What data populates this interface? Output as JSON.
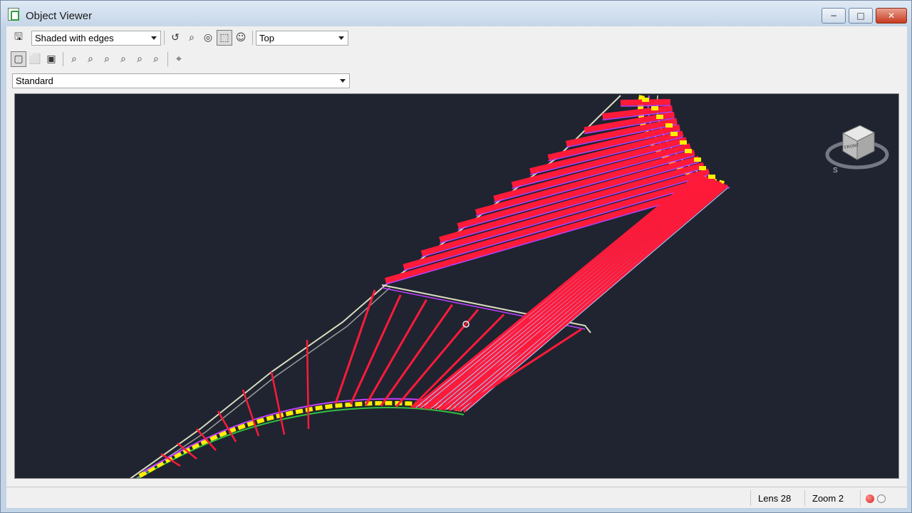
{
  "window": {
    "title": "Object Viewer"
  },
  "toolbar": {
    "visual_style": {
      "value": "Shaded with edges"
    },
    "view": {
      "value": "Top"
    },
    "icons_row1": [
      "save-icon",
      "orbit-icon",
      "zoom-icon",
      "pan-icon",
      "zoom-window-icon",
      "camera-icon"
    ],
    "icons_row2": [
      "view-front-icon",
      "view-iso-icon",
      "view-3d-icon",
      "zoom-in-icon",
      "zoom-out-icon",
      "zoom-extents-icon",
      "zoom-all-icon",
      "zoom-previous-icon",
      "zoom-realtime-icon",
      "crosshair-icon"
    ],
    "style_select": {
      "value": "Standard"
    }
  },
  "viewport": {
    "viewcube_face": "FRONT",
    "compass_letter": "S",
    "background": "#1f2430",
    "colors": {
      "beam": "#ff1a3a",
      "edge": "#c040ff",
      "highlight": "#ffee00",
      "outline": "#dcdcc0",
      "curve_green": "#30c040"
    }
  },
  "status": {
    "lens": "Lens 28",
    "zoom": "Zoom 2"
  }
}
